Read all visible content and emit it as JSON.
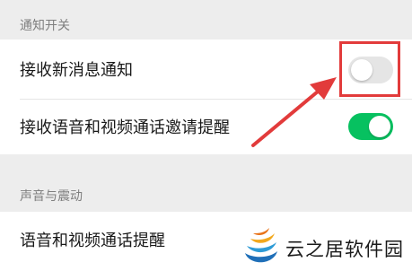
{
  "sections": {
    "notify_title": "通知开关",
    "sound_title": "声音与震动"
  },
  "rows": {
    "new_message": {
      "label": "接收新消息通知",
      "toggle": "off"
    },
    "voice_video_invite": {
      "label": "接收语音和视频通话邀请提醒",
      "toggle": "on"
    },
    "voice_video_alert": {
      "label": "语音和视频通话提醒"
    }
  },
  "colors": {
    "toggle_on": "#07c160",
    "toggle_off": "#e5e5e5",
    "annotation": "#e23b3b"
  },
  "watermark": {
    "text": "云之居软件园"
  }
}
